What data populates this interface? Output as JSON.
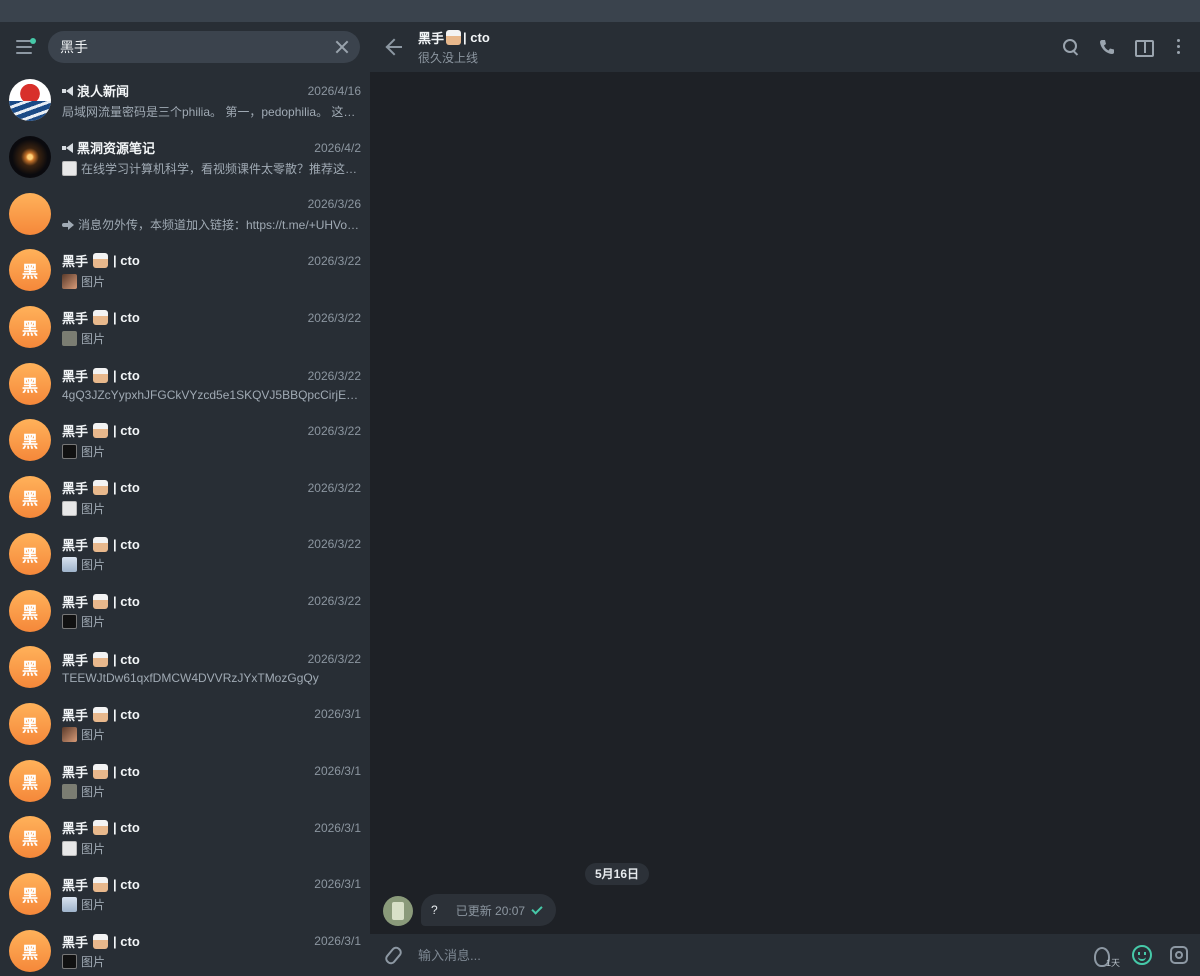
{
  "search": {
    "value": "黑手"
  },
  "chats": [
    {
      "name": "浪人新闻",
      "channel": true,
      "date": "2026/4/16",
      "preview": "局域网流量密码是三个philia。 第一，pedophilia。 这…",
      "avatar": "wave",
      "thumb": "",
      "forward": false
    },
    {
      "name": "黑洞资源笔记",
      "channel": true,
      "date": "2026/4/2",
      "preview": "在线学习计算机科学，看视频课件太零散？推荐这个…",
      "avatar": "galaxy",
      "thumb": "t-doc",
      "forward": false
    },
    {
      "name": "",
      "channel": false,
      "date": "2026/3/26",
      "preview": "消息勿外传，本频道加入链接：https://t.me/+UHVo…",
      "avatar": "plain",
      "thumb": "",
      "forward": true
    },
    {
      "name": "黑手",
      "suffix": "| cto",
      "date": "2026/3/22",
      "preview": "图片",
      "avatar": "orange",
      "avatar_char": "黑",
      "thumb": "t-face"
    },
    {
      "name": "黑手",
      "suffix": "| cto",
      "date": "2026/3/22",
      "preview": "图片",
      "avatar": "orange",
      "avatar_char": "黑",
      "thumb": "t-grey"
    },
    {
      "name": "黑手",
      "suffix": "| cto",
      "date": "2026/3/22",
      "preview": "4gQ3JZcYypxhJFGCkVYzcd5e1SKQVJ5BBQpcCirjE8GC",
      "avatar": "orange",
      "avatar_char": "黑",
      "thumb": ""
    },
    {
      "name": "黑手",
      "suffix": "| cto",
      "date": "2026/3/22",
      "preview": "图片",
      "avatar": "orange",
      "avatar_char": "黑",
      "thumb": "t-dark"
    },
    {
      "name": "黑手",
      "suffix": "| cto",
      "date": "2026/3/22",
      "preview": "图片",
      "avatar": "orange",
      "avatar_char": "黑",
      "thumb": "t-doc"
    },
    {
      "name": "黑手",
      "suffix": "| cto",
      "date": "2026/3/22",
      "preview": "图片",
      "avatar": "orange",
      "avatar_char": "黑",
      "thumb": "t-card"
    },
    {
      "name": "黑手",
      "suffix": "| cto",
      "date": "2026/3/22",
      "preview": "图片",
      "avatar": "orange",
      "avatar_char": "黑",
      "thumb": "t-dark"
    },
    {
      "name": "黑手",
      "suffix": "| cto",
      "date": "2026/3/22",
      "preview": "TEEWJtDw61qxfDMCW4DVVRzJYxTMozGgQy",
      "avatar": "orange",
      "avatar_char": "黑",
      "thumb": ""
    },
    {
      "name": "黑手",
      "suffix": "| cto",
      "date": "2026/3/1",
      "preview": "图片",
      "avatar": "orange",
      "avatar_char": "黑",
      "thumb": "t-face"
    },
    {
      "name": "黑手",
      "suffix": "| cto",
      "date": "2026/3/1",
      "preview": "图片",
      "avatar": "orange",
      "avatar_char": "黑",
      "thumb": "t-grey"
    },
    {
      "name": "黑手",
      "suffix": "| cto",
      "date": "2026/3/1",
      "preview": "图片",
      "avatar": "orange",
      "avatar_char": "黑",
      "thumb": "t-doc"
    },
    {
      "name": "黑手",
      "suffix": "| cto",
      "date": "2026/3/1",
      "preview": "图片",
      "avatar": "orange",
      "avatar_char": "黑",
      "thumb": "t-card"
    },
    {
      "name": "黑手",
      "suffix": "| cto",
      "date": "2026/3/1",
      "preview": "图片",
      "avatar": "orange",
      "avatar_char": "黑",
      "thumb": "t-dark"
    }
  ],
  "header": {
    "name": "黑手",
    "suffix": "| cto",
    "status": "很久没上线"
  },
  "conversation": {
    "date_pill": "5月16日",
    "message": {
      "text": "?",
      "meta": "已更新 20:07"
    }
  },
  "composer": {
    "placeholder": "输入消息...",
    "timer_label": "1天"
  },
  "colors": {
    "accent": "#46c9a8",
    "avatar_orange": "#f5883a",
    "sidebar_bg": "#282e35",
    "chat_bg": "#1e2126"
  }
}
